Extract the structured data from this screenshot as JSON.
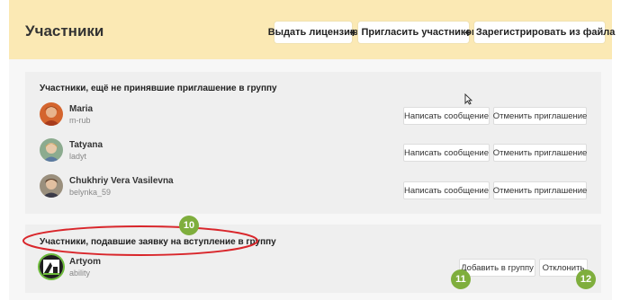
{
  "header": {
    "title": "Участники",
    "issue_license_label": "Выдать лицензию",
    "invite_label": "Пригласить участников",
    "register_from_file_label": "Зарегистрировать из файла"
  },
  "invited_section": {
    "title": "Участники, ещё не принявшие приглашение в группу",
    "members": [
      {
        "name": "Maria",
        "login": "m-rub",
        "write_label": "Написать сообщение",
        "cancel_label": "Отменить приглашение"
      },
      {
        "name": "Tatyana",
        "login": "ladyt",
        "write_label": "Написать сообщение",
        "cancel_label": "Отменить приглашение"
      },
      {
        "name": "Chukhriy Vera Vasilevna",
        "login": "belynka_59",
        "write_label": "Написать сообщение",
        "cancel_label": "Отменить приглашение"
      }
    ]
  },
  "requests_section": {
    "title": "Участники, подавшие заявку на вступление в группу",
    "members": [
      {
        "name": "Artyom",
        "login": "ability",
        "add_label": "Добавить в группу",
        "reject_label": "Отклонить"
      }
    ]
  },
  "annotations": {
    "badge_10": "10",
    "badge_11": "11",
    "badge_12": "12",
    "badge_color": "#7fae3d",
    "ellipse_color": "#d9262b"
  },
  "colors": {
    "header_bg": "#fbe9b4",
    "card_bg": "#efefef"
  }
}
